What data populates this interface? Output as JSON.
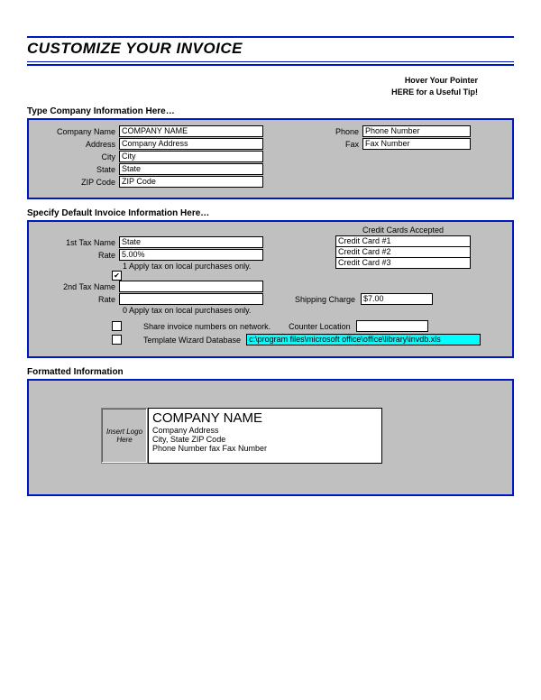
{
  "title": "CUSTOMIZE YOUR INVOICE",
  "hint": {
    "l1": "Hover Your Pointer",
    "l2": "HERE for a Useful Tip!"
  },
  "section1": {
    "heading": "Type Company Information Here…",
    "labels": {
      "company": "Company Name",
      "address": "Address",
      "city": "City",
      "state": "State",
      "zip": "ZIP Code",
      "phone": "Phone",
      "fax": "Fax"
    },
    "values": {
      "company": "COMPANY NAME",
      "address": "Company Address",
      "city": "City",
      "state": "State",
      "zip": "ZIP Code",
      "phone": "Phone Number",
      "fax": "Fax Number"
    }
  },
  "section2": {
    "heading": "Specify Default Invoice Information Here…",
    "labels": {
      "tax1": "1st Tax Name",
      "rate": "Rate",
      "tax2": "2nd Tax Name",
      "shipping": "Shipping Charge",
      "cc": "Credit Cards Accepted",
      "counter": "Counter Location",
      "share": "Share invoice numbers on network.",
      "db": "Template Wizard Database"
    },
    "values": {
      "tax1_name": "State",
      "tax1_rate": "5.00%",
      "tax1_note": "1 Apply tax on local purchases only.",
      "tax2_name": "",
      "tax2_rate": "",
      "tax2_note": "0 Apply tax on local purchases only.",
      "shipping": "$7.00",
      "counter": "",
      "db": "c:\\program files\\microsoft office\\office\\library\\invdb.xls"
    },
    "cc": [
      "Credit Card #1",
      "Credit Card #2",
      "Credit Card #3"
    ],
    "check1": "✔"
  },
  "section3": {
    "heading": "Formatted Information",
    "logo": "Insert\nLogo\nHere",
    "card": {
      "name": "COMPANY NAME",
      "address": "Company Address",
      "citystate": "City, State  ZIP Code",
      "phone": "Phone Number fax Fax Number"
    }
  }
}
